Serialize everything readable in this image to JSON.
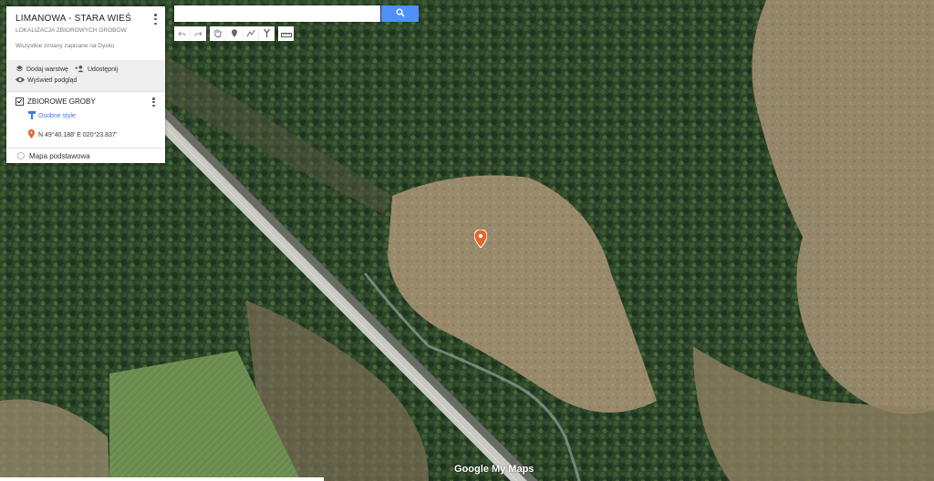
{
  "map_title": "LIMANOWA - STARA WIEŚ",
  "map_subtitle": "LOKALIZACJA ZBIOROWYCH GROBÓW",
  "save_status": "Wszystkie zmiany zapisane na Dysku",
  "actions": {
    "add_layer": "Dodaj warstwę",
    "share": "Udostępnij",
    "preview": "Wyświetl podgląd"
  },
  "layer": {
    "name": "ZBIOROWE GROBY",
    "style_label": "Osobne style",
    "place": "N 49°40.188' E 020°23.837'"
  },
  "base_map_label": "Mapa podstawowa",
  "search": {
    "value": "",
    "placeholder": ""
  },
  "logo": {
    "google": "Google",
    "suffix": " My Maps"
  },
  "colors": {
    "search_button": "#4d90fe",
    "marker": "#e8642a",
    "link": "#3b78e7"
  },
  "toolbar_icons": [
    "undo-icon",
    "redo-icon",
    "hand-icon",
    "marker-icon",
    "draw-line-icon",
    "directions-icon",
    "ruler-icon"
  ]
}
